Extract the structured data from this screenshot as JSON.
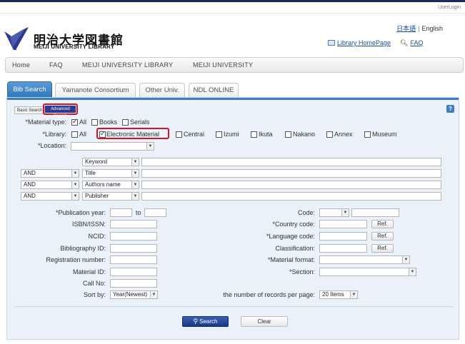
{
  "header": {
    "user_login": "UserLogin",
    "logo_jp": "明治大学図書館",
    "logo_en": "MEIJI UNIVERSITY LIBRARY",
    "lang_jp": "日本語",
    "lang_sep": "|",
    "lang_en": "English",
    "library_homepage": "Library HomePage",
    "faq_link": "FAQ"
  },
  "nav": {
    "items": [
      "Home",
      "FAQ",
      "MEIJI UNIVERSITY LIBRARY",
      "MEIJI UNIVERSITY"
    ]
  },
  "tabs": [
    "Bib Search",
    "Yamanote Consortium",
    "Other Univ.",
    "NDL ONLINE"
  ],
  "panel": {
    "basic_search": "Basic Search",
    "advanced_search": "Advanced Search",
    "help_icon": "?",
    "material_type_label": "*Material type:",
    "material_types": [
      {
        "label": "All",
        "checked": true
      },
      {
        "label": "Books",
        "checked": false
      },
      {
        "label": "Serials",
        "checked": false
      }
    ],
    "library_label": "*Library:",
    "libraries": [
      {
        "label": "All",
        "checked": false
      },
      {
        "label": "Electronic Material",
        "checked": true
      },
      {
        "label": "Central",
        "checked": false
      },
      {
        "label": "Izumi",
        "checked": false
      },
      {
        "label": "Ikuta",
        "checked": false
      },
      {
        "label": "Nakano",
        "checked": false
      },
      {
        "label": "Annex",
        "checked": false
      },
      {
        "label": "Museum",
        "checked": false
      }
    ],
    "location_label": "*Location:",
    "query_rows": [
      {
        "operator": "",
        "field": "Keyword"
      },
      {
        "operator": "AND",
        "field": "Title"
      },
      {
        "operator": "AND",
        "field": "Authors name"
      },
      {
        "operator": "AND",
        "field": "Publisher"
      }
    ],
    "left_fields": {
      "pub_year": "*Publication year:",
      "pub_year_to": "to",
      "isbn": "ISBN/ISSN:",
      "ncid": "NCID:",
      "bib_id": "Bibliography ID:",
      "reg_no": "Registration number:",
      "material_id": "Material ID:",
      "call_no": "Call No:",
      "sort_by": "Sort by:",
      "sort_value": "Year(Newest)"
    },
    "right_fields": {
      "code": "Code:",
      "country_code": "*Country code:",
      "language_code": "*Language code:",
      "classification": "Classification:",
      "material_format": "*Material format:",
      "section": "*Section:",
      "records_per_page": "the number of records per page:",
      "records_value": "20 Items",
      "ref": "Ref."
    },
    "search_button": "Search",
    "clear_button": "Clear"
  },
  "colors": {
    "accent_blue": "#2f73b8",
    "highlight_red": "#d3122a",
    "panel_bg": "#eaf1f8",
    "link": "#1a4fa0"
  }
}
